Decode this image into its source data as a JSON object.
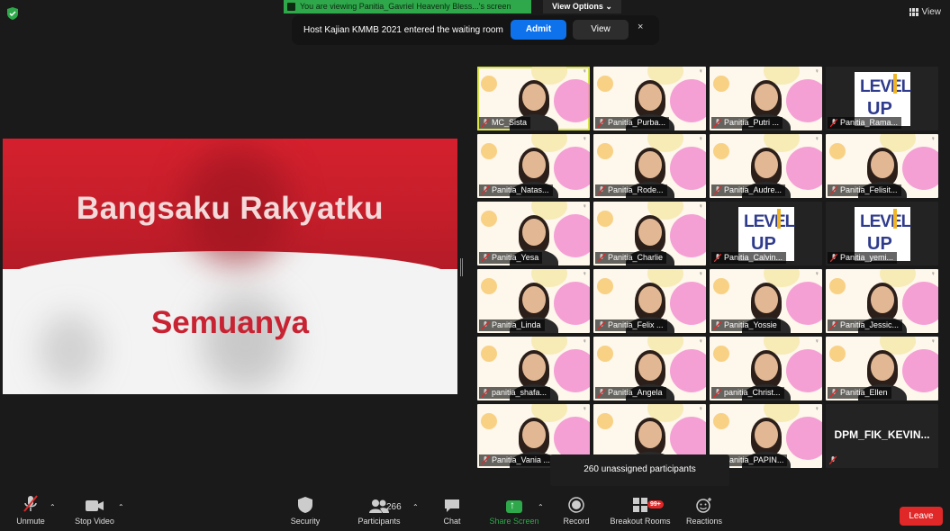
{
  "top": {
    "viewing_banner": "You are viewing Panitia_Gavriel Heavenly Bless...'s screen",
    "view_options": "View Options",
    "view_label": "View"
  },
  "notification": {
    "message": "Host Kajian KMMB 2021 entered the waiting room",
    "admit_label": "Admit",
    "view_label": "View",
    "close_glyph": "×"
  },
  "shared_screen": {
    "title": "Bangsaku Rakyatku",
    "subtitle": "Semuanya"
  },
  "participants": [
    {
      "name": "MC_Sista",
      "kind": "video",
      "active": true
    },
    {
      "name": "Panitia_Purba...",
      "kind": "video"
    },
    {
      "name": "Panitia_Putri ...",
      "kind": "video"
    },
    {
      "name": "Panitia_Rama...",
      "kind": "logo"
    },
    {
      "name": "Panitia_Natas...",
      "kind": "video"
    },
    {
      "name": "Panitia_Rode...",
      "kind": "video"
    },
    {
      "name": "Panitia_Audre...",
      "kind": "video"
    },
    {
      "name": "Panitia_Felisit...",
      "kind": "video"
    },
    {
      "name": "Panitia_Yesa",
      "kind": "video"
    },
    {
      "name": "Panitia_Charlie",
      "kind": "video"
    },
    {
      "name": "Panitia_Calvin...",
      "kind": "logo"
    },
    {
      "name": "Panitia_yemi...",
      "kind": "logo"
    },
    {
      "name": "Panitia_Linda",
      "kind": "video"
    },
    {
      "name": "Panitia_Felix ...",
      "kind": "video"
    },
    {
      "name": "Panitia_Yossie",
      "kind": "video"
    },
    {
      "name": "Panitia_Jessic...",
      "kind": "video"
    },
    {
      "name": "panitia_shafa...",
      "kind": "video"
    },
    {
      "name": "Panitia_Angela",
      "kind": "video"
    },
    {
      "name": "panitia_Christ...",
      "kind": "video"
    },
    {
      "name": "Panitia_Ellen",
      "kind": "video"
    },
    {
      "name": "Panitia_Vania ...",
      "kind": "video"
    },
    {
      "name": "",
      "kind": "video"
    },
    {
      "name": "Panitia_PAPIN...",
      "kind": "video"
    },
    {
      "name": "DPM_FIK_KEVIN...",
      "kind": "name-only"
    }
  ],
  "logo_text": {
    "line1": "LEVEL",
    "line2": "UP"
  },
  "unassigned": "260 unassigned participants",
  "toolbar": {
    "unmute": "Unmute",
    "stop_video": "Stop Video",
    "security": "Security",
    "participants": "Participants",
    "participants_count": "266",
    "chat": "Chat",
    "share_screen": "Share Screen",
    "record": "Record",
    "breakout_rooms": "Breakout Rooms",
    "breakout_badge": "99+",
    "reactions": "Reactions",
    "leave": "Leave"
  },
  "colors": {
    "accent_blue": "#0e72ed",
    "share_green": "#2ea84a",
    "leave_red": "#e02828",
    "active_speaker": "#d9e34a"
  }
}
